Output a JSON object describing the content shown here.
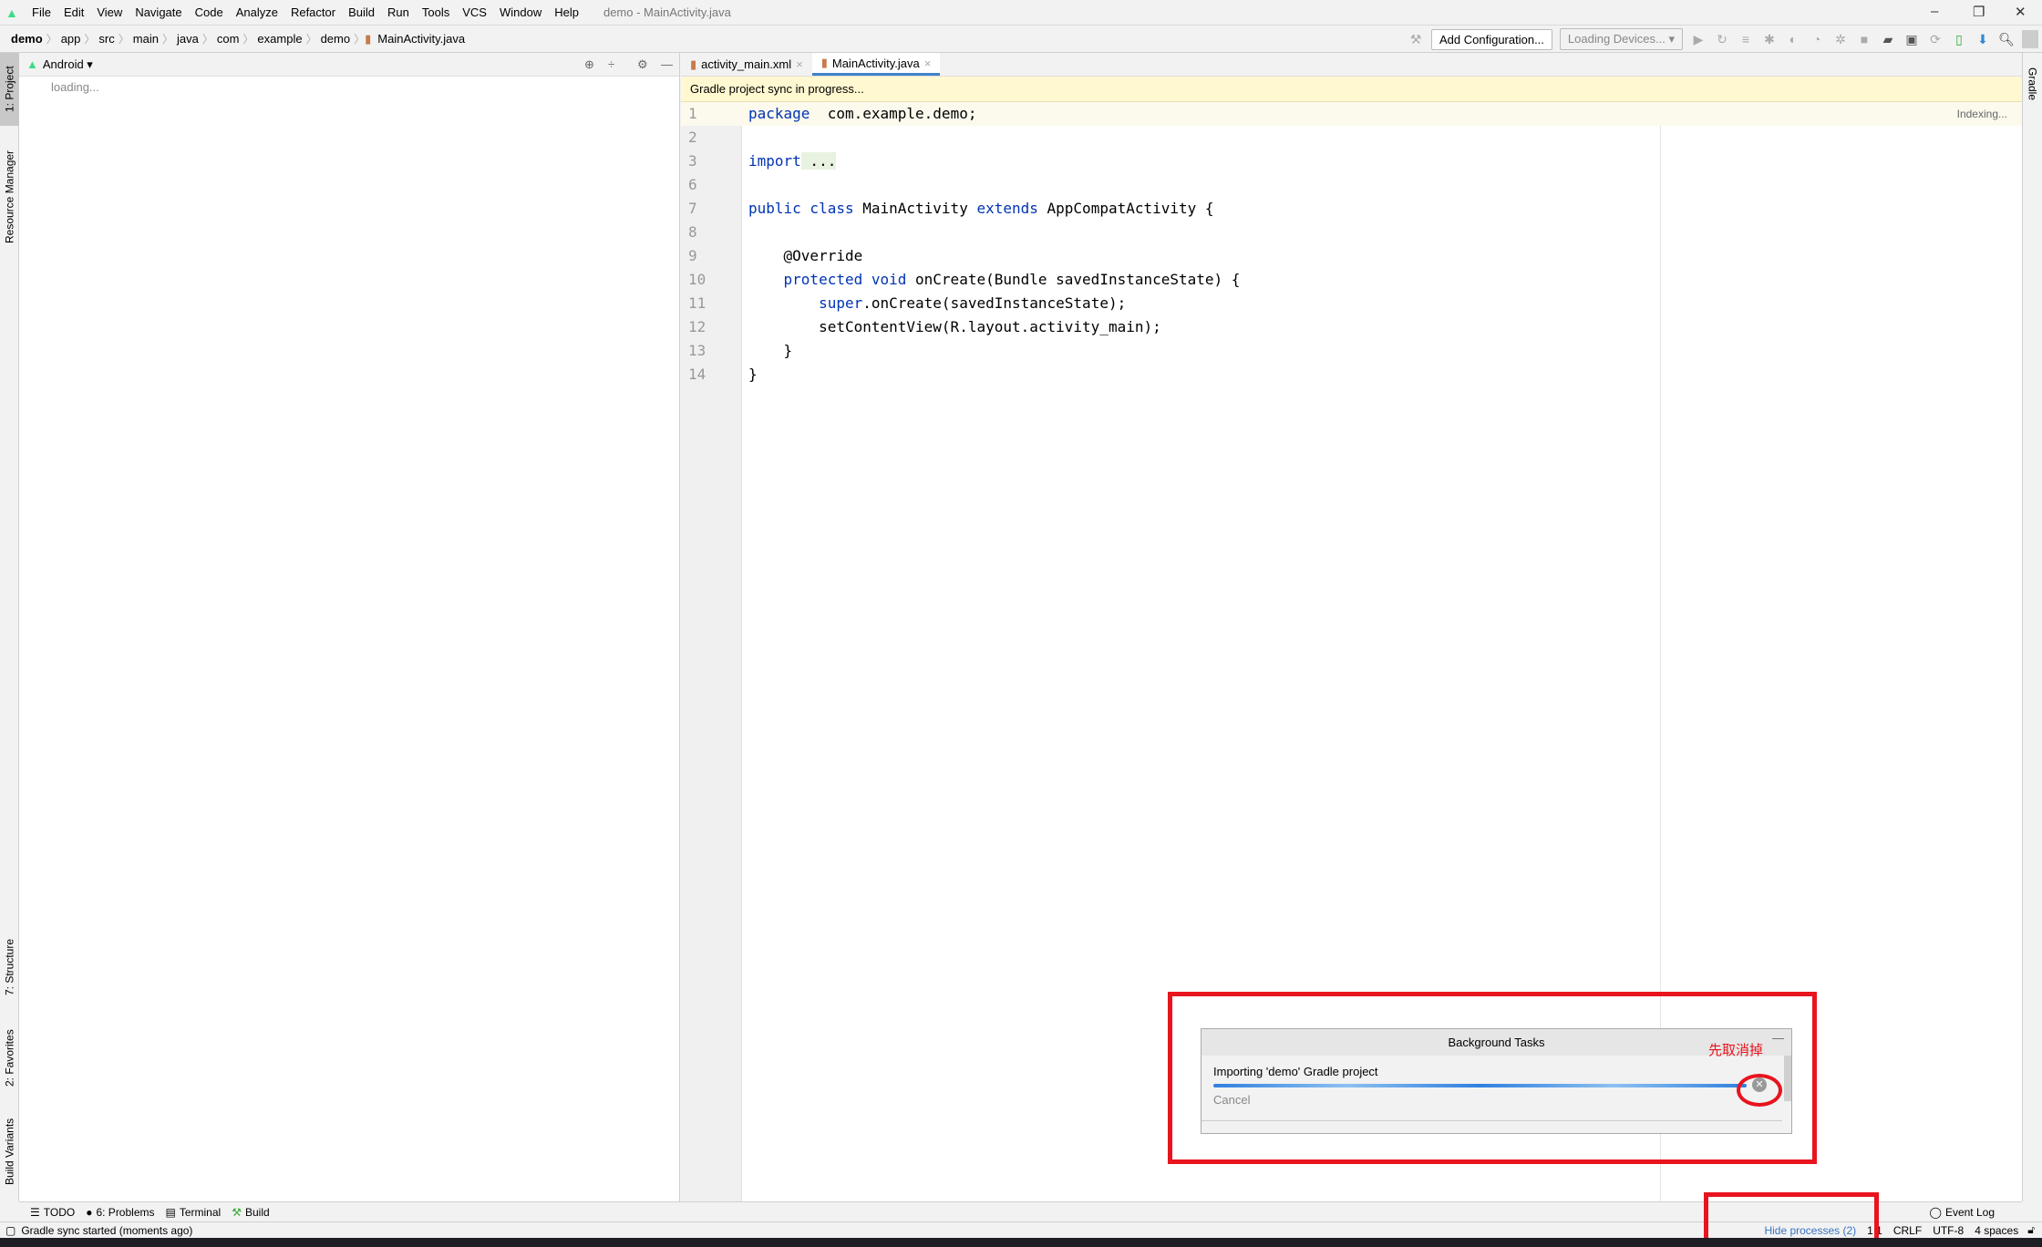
{
  "menu": {
    "items": [
      "File",
      "Edit",
      "View",
      "Navigate",
      "Code",
      "Analyze",
      "Refactor",
      "Build",
      "Run",
      "Tools",
      "VCS",
      "Window",
      "Help"
    ],
    "window_title": "demo - MainActivity.java"
  },
  "breadcrumb": [
    "demo",
    "app",
    "src",
    "main",
    "java",
    "com",
    "example",
    "demo",
    "MainActivity.java"
  ],
  "toolbar": {
    "add_config": "Add Configuration...",
    "devices": "Loading Devices..."
  },
  "left_rail": {
    "project": "1: Project",
    "resource_manager": "Resource Manager",
    "structure": "7: Structure",
    "favorites": "2: Favorites",
    "build_variants": "Build Variants"
  },
  "right_rail": {
    "gradle": "Gradle"
  },
  "project_panel": {
    "view": "Android",
    "loading": "loading..."
  },
  "editor": {
    "tabs": [
      "activity_main.xml",
      "MainActivity.java"
    ],
    "active_tab": 1,
    "banner": "Gradle project sync in progress...",
    "indexing": "Indexing...",
    "lines": [
      {
        "n": "1",
        "parts": [
          [
            "kw",
            "package"
          ],
          [
            "",
            "  com.example.demo;"
          ]
        ]
      },
      {
        "n": "2",
        "parts": []
      },
      {
        "n": "3",
        "parts": [
          [
            "kw",
            "import"
          ],
          [
            "fold",
            " ..."
          ]
        ]
      },
      {
        "n": "6",
        "parts": []
      },
      {
        "n": "7",
        "parts": [
          [
            "kw",
            "public class"
          ],
          [
            "",
            " MainActivity "
          ],
          [
            "kw",
            "extends"
          ],
          [
            "",
            " AppCompatActivity {"
          ]
        ]
      },
      {
        "n": "8",
        "parts": []
      },
      {
        "n": "9",
        "parts": [
          [
            "",
            "    @Override"
          ]
        ]
      },
      {
        "n": "10",
        "parts": [
          [
            "kw",
            "    protected void"
          ],
          [
            "",
            " onCreate(Bundle savedInstanceState) {"
          ]
        ]
      },
      {
        "n": "11",
        "parts": [
          [
            "kw",
            "        super"
          ],
          [
            "",
            ".onCreate(savedInstanceState);"
          ]
        ]
      },
      {
        "n": "12",
        "parts": [
          [
            "",
            "        setContentView(R.layout.activity_main);"
          ]
        ]
      },
      {
        "n": "13",
        "parts": [
          [
            "",
            "    }"
          ]
        ]
      },
      {
        "n": "14",
        "parts": [
          [
            "",
            "}"
          ]
        ]
      }
    ]
  },
  "background_tasks": {
    "title": "Background Tasks",
    "task": "Importing 'demo' Gradle project",
    "cancel": "Cancel",
    "progress_color": "#2f80e0"
  },
  "annotation": {
    "label": "先取消掉",
    "color": "#e8141e"
  },
  "tool_windows": {
    "todo": "TODO",
    "problems": "6: Problems",
    "terminal": "Terminal",
    "build": "Build",
    "event_log": "Event Log"
  },
  "status": {
    "message": "Gradle sync started (moments ago)",
    "hide_processes": "Hide processes (2)",
    "position": "1:1",
    "line_sep": "CRLF",
    "encoding": "UTF-8",
    "indent": "4 spaces"
  }
}
